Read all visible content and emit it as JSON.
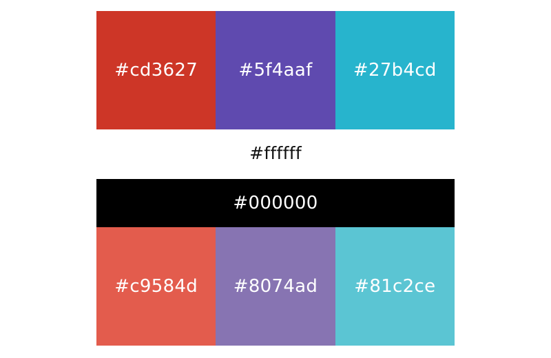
{
  "palette": {
    "primary": [
      {
        "hex": "#cd3627",
        "label": "#cd3627"
      },
      {
        "hex": "#5f4aaf",
        "label": "#5f4aaf"
      },
      {
        "hex": "#27b4cd",
        "label": "#27b4cd"
      }
    ],
    "white": {
      "hex": "#ffffff",
      "label": "#ffffff"
    },
    "black": {
      "hex": "#000000",
      "label": "#000000"
    },
    "tints": [
      {
        "hex": "#e35c4d",
        "label": "#c9584d"
      },
      {
        "hex": "#8774b2",
        "label": "#8074ad"
      },
      {
        "hex": "#5bc5d3",
        "label": "#81c2ce"
      }
    ]
  }
}
